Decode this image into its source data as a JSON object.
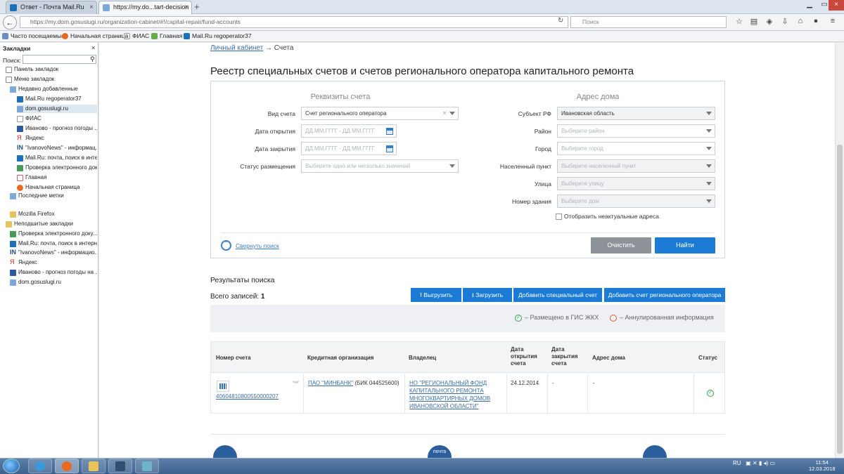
{
  "browser": {
    "tabs": [
      {
        "title": "Ответ - Почта Mail.Ru",
        "active": false
      },
      {
        "title": "https://my.do...tart-decision",
        "active": true
      }
    ],
    "new_tab": "+",
    "url": "https://my.dom.gosuslugi.ru/organization-cabinet/#!/capital-repair/fund-accounts",
    "search_placeholder": "Поиск",
    "bookmarks_bar": [
      "Часто посещаемые",
      "Начальная страница",
      "ФИАС",
      "Главная",
      "Mail.Ru regoperator37"
    ]
  },
  "sidebar": {
    "title": "Закладки",
    "close": "×",
    "search_label": "Поиск:",
    "items": [
      "Панель закладок",
      "Меню закладок",
      "Недавно добавленные",
      "Mail.Ru regoperator37",
      "dom.gosuslugi.ru",
      "ФИАС",
      "Иваново - прогноз погоды ...",
      "Яндекс",
      "\"IvanovoNews\" - информац...",
      "Mail.Ru: почта, поиск в инте...",
      "Проверка электронного док...",
      "Главная",
      "Начальная страница",
      "Последние метки",
      "Mozilla Firefox",
      "Неподшитые закладки",
      "Проверка электронного доку...",
      "Mail.Ru: почта, поиск в интерн...",
      "\"IvanovoNews\" - информацио...",
      "Яндекс",
      "Иваново - прогноз погоды на ...",
      "dom.gosuslugi.ru"
    ]
  },
  "breadcrumb": {
    "link": "Личный кабинет",
    "sep": "→",
    "current": "Счета"
  },
  "page_title": "Реестр специальных счетов и счетов регионального оператора капитального ремонта",
  "filter": {
    "account_section": "Реквизиты счета",
    "address_section": "Адрес дома",
    "account_type_label": "Вид счета",
    "account_type_value": "Счет регионального оператора",
    "open_date_label": "Дата открытия",
    "close_date_label": "Дата закрытия",
    "date_placeholder": "ДД.ММ.ГГГГ - ДД.ММ.ГГГГ",
    "status_label": "Статус размещения",
    "status_placeholder": "Выберите одно или несколько значений",
    "region_label": "Субъект РФ",
    "region_value": "Ивановская область",
    "district_label": "Район",
    "district_placeholder": "Выберите район",
    "city_label": "Город",
    "city_placeholder": "Выберите город",
    "locality_label": "Населенный пункт",
    "locality_placeholder": "Выберите населенный пункт",
    "street_label": "Улица",
    "street_placeholder": "Выберите улицу",
    "house_label": "Номер здания",
    "house_placeholder": "Выберите дом",
    "show_inactive": "Отобразить неактуальные адреса",
    "collapse": "Свернуть поиск",
    "clear": "Очистить",
    "find": "Найти"
  },
  "results": {
    "title": "Результаты поиска",
    "total_label": "Всего записей:",
    "total": "1",
    "buttons": [
      "Выгрузить",
      "Загрузить",
      "Добавить специальный счет",
      "Добавить счет регионального оператора"
    ],
    "legend_placed": "– Размещено в ГИС ЖКХ",
    "legend_annulled": "– Аннулированная информация",
    "columns": [
      "Номер счета",
      "Кредитная организация",
      "Владелец",
      "Дата открытия счета",
      "Дата закрытия счета",
      "Адрес дома",
      "Статус"
    ],
    "rows": [
      {
        "account": "40604810800550000207",
        "bank": "ПАО \"МИНБАНК\"",
        "bik": "(БИК 044525600)",
        "owner": "НО \"РЕГИОНАЛЬНЫЙ ФОНД КАПИТАЛЬНОГО РЕМОНТА МНОГОКВАРТИРНЫХ ДОМОВ ИВАНОВСКОЙ ОБЛАСТИ\"",
        "opened": "24.12.2014",
        "closed": "-",
        "address": "-"
      }
    ]
  },
  "footer_logo_text": "почта",
  "taskbar": {
    "lang": "RU",
    "time": "11:54",
    "date": "12.03.2018"
  }
}
